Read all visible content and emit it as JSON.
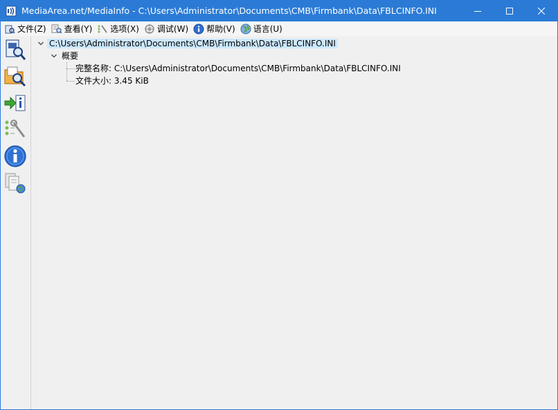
{
  "window": {
    "title": "MediaArea.net/MediaInfo - C:\\Users\\Administrator\\Documents\\CMB\\Firmbank\\Data\\FBLCINFO.INI",
    "accent_color": "#2b7bd6"
  },
  "menu": [
    {
      "label": "文件(Z)",
      "icon": "file-open-icon"
    },
    {
      "label": "查看(Y)",
      "icon": "view-icon"
    },
    {
      "label": "选项(X)",
      "icon": "options-icon"
    },
    {
      "label": "调试(W)",
      "icon": "debug-icon"
    },
    {
      "label": "帮助(V)",
      "icon": "help-icon"
    },
    {
      "label": "语言(U)",
      "icon": "language-icon"
    }
  ],
  "toolbar": [
    {
      "icon": "open-file-icon"
    },
    {
      "icon": "open-folder-icon"
    },
    {
      "icon": "export-info-icon"
    },
    {
      "icon": "preferences-icon"
    },
    {
      "icon": "about-info-icon"
    },
    {
      "icon": "knowledge-base-icon"
    }
  ],
  "tree": {
    "root": "C:\\Users\\Administrator\\Documents\\CMB\\Firmbank\\Data\\FBLCINFO.INI",
    "section": "概要",
    "fields": [
      {
        "text": "完整名称: C:\\Users\\Administrator\\Documents\\CMB\\Firmbank\\Data\\FBLCINFO.INI"
      },
      {
        "text": "文件大小: 3.45 KiB"
      }
    ]
  }
}
